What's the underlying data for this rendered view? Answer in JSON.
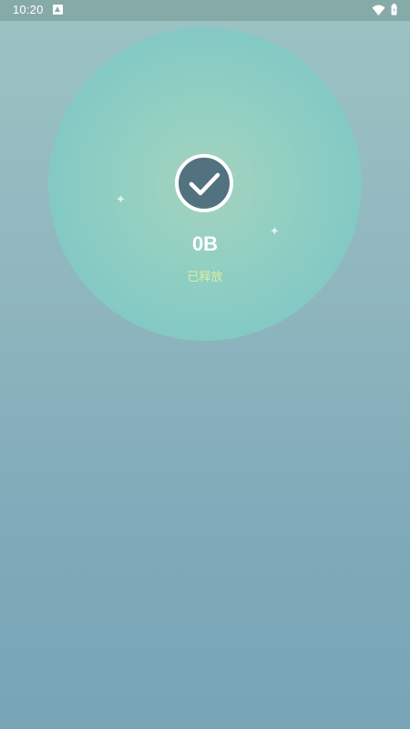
{
  "status_bar": {
    "time": "10:20",
    "notification_icon": "app-notification-icon",
    "wifi_icon": "wifi-icon",
    "battery_icon": "battery-icon"
  },
  "result": {
    "freed_size": "0B",
    "freed_label": "已释放",
    "check_icon": "checkmark-icon",
    "sparkle_icon": "sparkle-icon"
  },
  "colors": {
    "check_badge": "#53727f",
    "label_accent": "#d8f0a6",
    "circle_glow": "#84c9c4"
  }
}
